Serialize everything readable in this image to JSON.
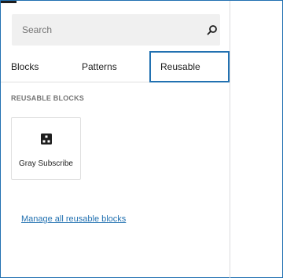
{
  "search": {
    "placeholder": "Search",
    "value": ""
  },
  "tabs": [
    {
      "label": "Blocks",
      "active": false
    },
    {
      "label": "Patterns",
      "active": false
    },
    {
      "label": "Reusable",
      "active": true
    }
  ],
  "section": {
    "title": "REUSABLE BLOCKS"
  },
  "blocks": [
    {
      "label": "Gray Subscribe",
      "icon": "reusable-block-icon"
    }
  ],
  "footer": {
    "manage_link": "Manage all reusable blocks"
  },
  "colors": {
    "accent": "#2271b1",
    "search_bg": "#f0f0f0",
    "text": "#1e1e1e",
    "muted": "#757575"
  }
}
